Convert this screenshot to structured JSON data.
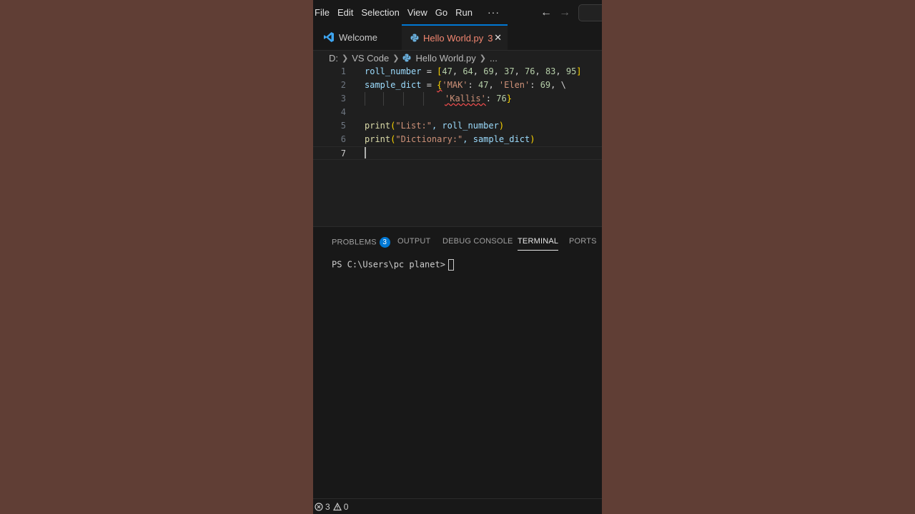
{
  "menubar": {
    "items": [
      "File",
      "Edit",
      "Selection",
      "View",
      "Go",
      "Run"
    ],
    "more": "···",
    "back_icon": "arrow-left-icon",
    "forward_icon": "arrow-right-icon"
  },
  "tabs": [
    {
      "label": "Welcome",
      "icon": "vscode-icon",
      "active": false
    },
    {
      "label": "Hello World.py",
      "icon": "python-file-icon",
      "problems": "3",
      "active": true,
      "close": "✕"
    }
  ],
  "breadcrumb": {
    "items": [
      "D:",
      "VS Code",
      "Hello World.py",
      "..."
    ]
  },
  "editor": {
    "line_numbers": [
      "1",
      "2",
      "3",
      "4",
      "5",
      "6",
      "7"
    ],
    "tokens": {
      "l1": [
        "roll_number",
        " = ",
        "[",
        "47",
        ", ",
        "64",
        ", ",
        "69",
        ", ",
        "37",
        ", ",
        "76",
        ", ",
        "83",
        ", ",
        "95",
        "]"
      ],
      "l2": [
        "sample_dict",
        " = ",
        "{",
        "'MAK'",
        ": ",
        "47",
        ", ",
        "'Elen'",
        ": ",
        "69",
        ", \\"
      ],
      "l3": [
        "'Kallis'",
        ": ",
        "76",
        "}"
      ],
      "l5": [
        "print",
        "(",
        "\"List:\"",
        ", roll_number",
        ")"
      ],
      "l6": [
        "print",
        "(",
        "\"Dictionary:\"",
        ", sample_dict",
        ")"
      ]
    }
  },
  "panel": {
    "tabs": [
      "PROBLEMS",
      "OUTPUT",
      "DEBUG CONSOLE",
      "TERMINAL",
      "PORTS"
    ],
    "problems_badge": "3",
    "active_tab": "TERMINAL",
    "terminal_prompt": "PS C:\\Users\\pc planet>"
  },
  "statusbar": {
    "errors": "3",
    "warnings": "0",
    "error_icon": "error-circle-icon",
    "warning_icon": "warning-triangle-icon"
  },
  "colors": {
    "background": "#603e35",
    "editor_bg": "#1f1f1f",
    "accent": "#0078d4",
    "error_tab": "#f48771"
  }
}
